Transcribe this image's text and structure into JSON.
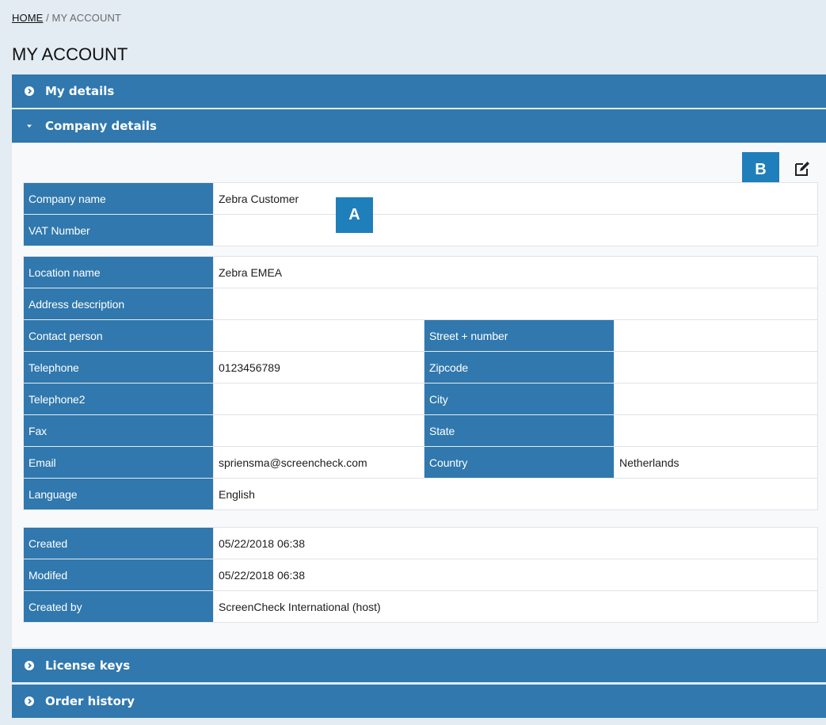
{
  "breadcrumb": {
    "home": "HOME",
    "separator": " / ",
    "current": "MY ACCOUNT"
  },
  "page_title": "MY ACCOUNT",
  "sections": {
    "my_details": "My details",
    "company_details": "Company details",
    "license_keys": "License keys",
    "order_history": "Order history"
  },
  "callouts": {
    "a": "A",
    "b": "B"
  },
  "company": {
    "company_name_label": "Company name",
    "company_name": "Zebra Customer",
    "vat_label": "VAT Number",
    "vat": ""
  },
  "location": {
    "location_name_label": "Location name",
    "location_name": "Zebra EMEA",
    "address_description_label": "Address description",
    "address_description": "",
    "contact_person_label": "Contact person",
    "contact_person": "",
    "street_label": "Street + number",
    "street": "",
    "telephone_label": "Telephone",
    "telephone": "0123456789",
    "zipcode_label": "Zipcode",
    "zipcode": "",
    "telephone2_label": "Telephone2",
    "telephone2": "",
    "city_label": "City",
    "city": "",
    "fax_label": "Fax",
    "fax": "",
    "state_label": "State",
    "state": "",
    "email_label": "Email",
    "email": "spriensma@screencheck.com",
    "country_label": "Country",
    "country": "Netherlands",
    "language_label": "Language",
    "language": "English"
  },
  "meta": {
    "created_label": "Created",
    "created": "05/22/2018 06:38",
    "modified_label": "Modifed",
    "modified": "05/22/2018 06:38",
    "created_by_label": "Created by",
    "created_by": "ScreenCheck International (host)"
  },
  "icons": {
    "collapsed": "circle-chevron-right-icon",
    "expanded": "caret-down-icon",
    "edit": "edit-icon"
  },
  "colors": {
    "header_blue": "#3078ad",
    "callout_blue": "#1f7fba",
    "background": "#e3ecf3"
  }
}
